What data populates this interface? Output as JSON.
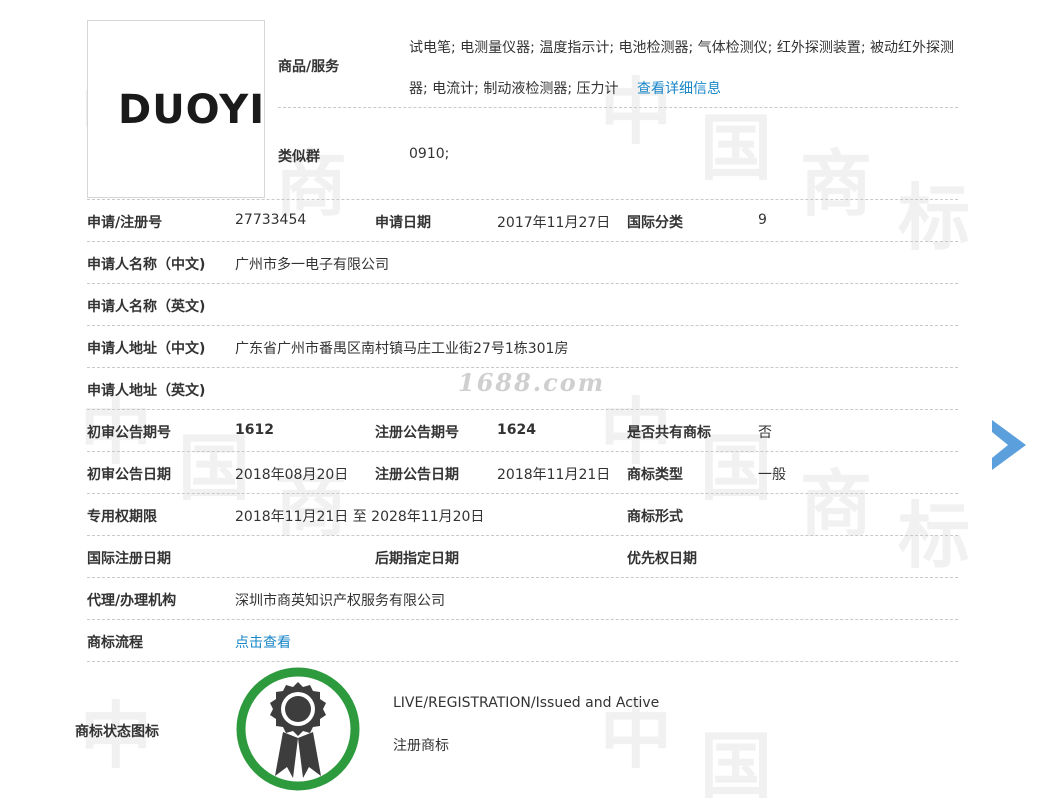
{
  "watermark": {
    "zhong": "中",
    "guo": "国",
    "shang": "商",
    "biao": "标",
    "site": "1688.com"
  },
  "logo": {
    "text": "DUOYI"
  },
  "goods": {
    "label": "商品/服务",
    "items": "试电笔; 电测量仪器; 温度指示计; 电池检测器; 气体检测仪; 红外探测装置; 被动红外探测器; 电流计; 制动液检测器; 压力计",
    "detail_link": "查看详细信息"
  },
  "similar_group": {
    "label": "类似群",
    "value": "0910;"
  },
  "details": {
    "reg_no": {
      "label": "申请/注册号",
      "value": "27733454"
    },
    "apply_date": {
      "label": "申请日期",
      "value": "2017年11月27日"
    },
    "intl_class": {
      "label": "国际分类",
      "value": "9"
    },
    "applicant_cn": {
      "label": "申请人名称（中文)",
      "value": "广州市多一电子有限公司"
    },
    "applicant_en": {
      "label": "申请人名称（英文)",
      "value": ""
    },
    "address_cn": {
      "label": "申请人地址（中文)",
      "value": "广东省广州市番禺区南村镇马庄工业街27号1栋301房"
    },
    "address_en": {
      "label": "申请人地址（英文)",
      "value": ""
    },
    "prelim_pub_no": {
      "label": "初审公告期号",
      "value": "1612"
    },
    "reg_pub_no": {
      "label": "注册公告期号",
      "value": "1624"
    },
    "shared_mark": {
      "label": "是否共有商标",
      "value": "否"
    },
    "prelim_pub_date": {
      "label": "初审公告日期",
      "value": "2018年08月20日"
    },
    "reg_pub_date": {
      "label": "注册公告日期",
      "value": "2018年11月21日"
    },
    "mark_type": {
      "label": "商标类型",
      "value": "一般"
    },
    "exclusive_period": {
      "label": "专用权期限",
      "value": "2018年11月21日 至 2028年11月20日"
    },
    "mark_form": {
      "label": "商标形式",
      "value": ""
    },
    "intl_reg_date": {
      "label": "国际注册日期",
      "value": ""
    },
    "later_desig_date": {
      "label": "后期指定日期",
      "value": ""
    },
    "priority_date": {
      "label": "优先权日期",
      "value": ""
    },
    "agent": {
      "label": "代理/办理机构",
      "value": "深圳市商英知识产权服务有限公司"
    },
    "process": {
      "label": "商标流程",
      "link": "点击查看"
    },
    "status_icon": {
      "label": "商标状态图标",
      "status_en": "LIVE/REGISTRATION/Issued and Active",
      "status_cn": "注册商标"
    }
  },
  "colors": {
    "link": "#1a86c8",
    "arrow": "#5b9fdc",
    "badge_ring": "#2e9a3e",
    "badge_dark": "#3d3d3d"
  }
}
